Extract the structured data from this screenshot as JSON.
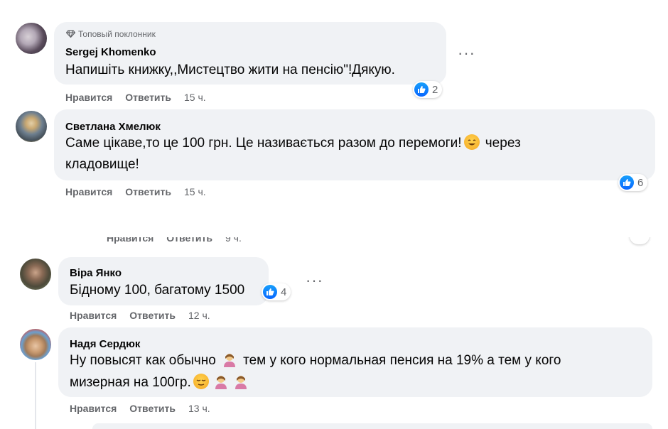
{
  "comments": [
    {
      "badge": "Топовый поклонник",
      "author": "Sergej Khomenko",
      "text": "Напишіть книжку,,Мистецтво жити на пенсію\"!Дякую.",
      "likes": "2",
      "like_label": "Нравится",
      "reply_label": "Ответить",
      "time": "15 ч."
    },
    {
      "author": "Светлана Хмелюк",
      "text_line1a": "Саме цікаве,то це 100 грн. Це називається разом до перемоги!",
      "text_line1b": "через",
      "text_line2": "кладовище!",
      "likes": "6",
      "like_label": "Нравится",
      "reply_label": "Ответить",
      "time": "15 ч."
    },
    {
      "partial_like": "Нравится",
      "partial_reply": "Ответить",
      "partial_time": "9 ч."
    },
    {
      "author": "Віра Янко",
      "text": "Бідному 100, багатому 1500",
      "likes": "4",
      "like_label": "Нравится",
      "reply_label": "Ответить",
      "time": "12 ч."
    },
    {
      "author": "Надя Сердюк",
      "text_line1a": "Ну повысят как обычно",
      "text_line1b": "тем у кого нормальная пенсия на 19% а тем у кого",
      "text_line2": "мизерная на 100гр.",
      "like_label": "Нравится",
      "reply_label": "Ответить",
      "time": "13 ч."
    }
  ],
  "icons": {
    "badge": "diamond-icon",
    "like": "thumbs-up-icon",
    "more": "more-options-icon",
    "emoji_smile": "smiling-emoji-icon",
    "emoji_person": "person-gesture-emoji-icon",
    "emoji_relieved": "relieved-emoji-icon"
  },
  "colors": {
    "bubble": "#f0f2f5",
    "like_blue": "#0866ff",
    "meta_grey": "#65676b"
  }
}
